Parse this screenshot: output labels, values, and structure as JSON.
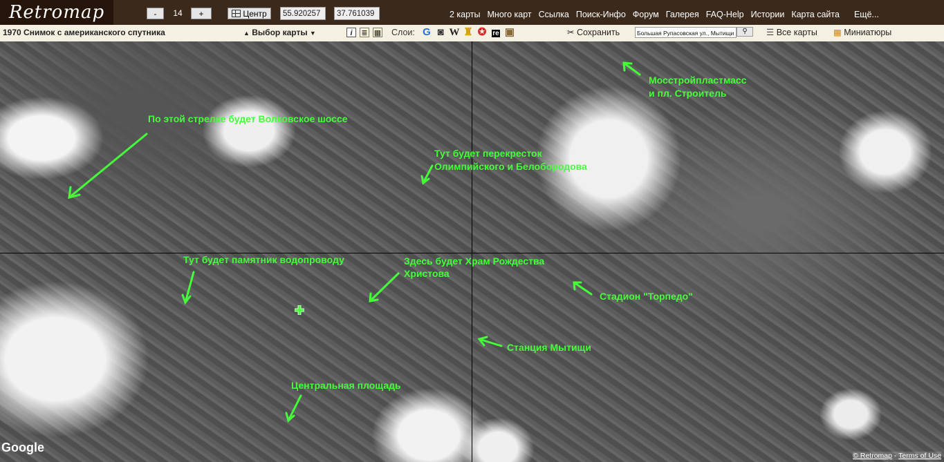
{
  "header": {
    "logo": "Retromap",
    "zoom_out": "-",
    "zoom_level": "14",
    "zoom_in": "+",
    "center_btn": "Центр",
    "lat": "55.920257",
    "lon": "37.761039",
    "nav": [
      "2 карты",
      "Много карт",
      "Ссылка",
      "Поиск-Инфо",
      "Форум",
      "Галерея",
      "FAQ-Help",
      "Истории",
      "Карта сайта",
      "Ещё..."
    ]
  },
  "toolbar": {
    "map_title": "1970 Снимок с американского спутника",
    "map_select": "Выбор карты",
    "layers_label": "Слои:",
    "layers": [
      {
        "icon": "google-icon",
        "glyph": "G",
        "color": "#2a6fe0"
      },
      {
        "icon": "camera-icon",
        "glyph": "◙",
        "color": "#333333"
      },
      {
        "icon": "wikipedia-icon",
        "glyph": "W",
        "color": "#222222"
      },
      {
        "icon": "church-icon",
        "glyph": "♜",
        "color": "#d4a20e"
      },
      {
        "icon": "star-icon",
        "glyph": "✪",
        "color": "#d12a2a"
      },
      {
        "icon": "re-icon",
        "glyph": "re",
        "color": "#000000"
      },
      {
        "icon": "photo-icon",
        "glyph": "▣",
        "color": "#8a6a3a"
      }
    ],
    "save": "Сохранить",
    "search_value": "Большая Рупасовская ул., Мытищи",
    "all_maps": "Все карты",
    "thumbnails": "Миниатюры"
  },
  "map": {
    "annotations": [
      {
        "id": "volokovskoe",
        "text": "По этой стрелке будет Волковское шоссе"
      },
      {
        "id": "crossroad-1",
        "text": "Тут будет перекресток"
      },
      {
        "id": "crossroad-2",
        "text": "Олимпийского и Белобородова"
      },
      {
        "id": "plastmass-1",
        "text": "Мосстройпластмасс"
      },
      {
        "id": "plastmass-2",
        "text": "и пл. Строитель"
      },
      {
        "id": "monument",
        "text": "Тут будет памятник водопроводу"
      },
      {
        "id": "temple-1",
        "text": "Здесь будет Храм Рождества"
      },
      {
        "id": "temple-2",
        "text": "Христова"
      },
      {
        "id": "stadium",
        "text": "Стадион \"Торпедо\""
      },
      {
        "id": "station",
        "text": "Станция Мытищи"
      },
      {
        "id": "square",
        "text": "Центральная площадь"
      }
    ],
    "google_logo": "Google",
    "copyright": "© Retromap",
    "terms": "Terms of Use"
  }
}
